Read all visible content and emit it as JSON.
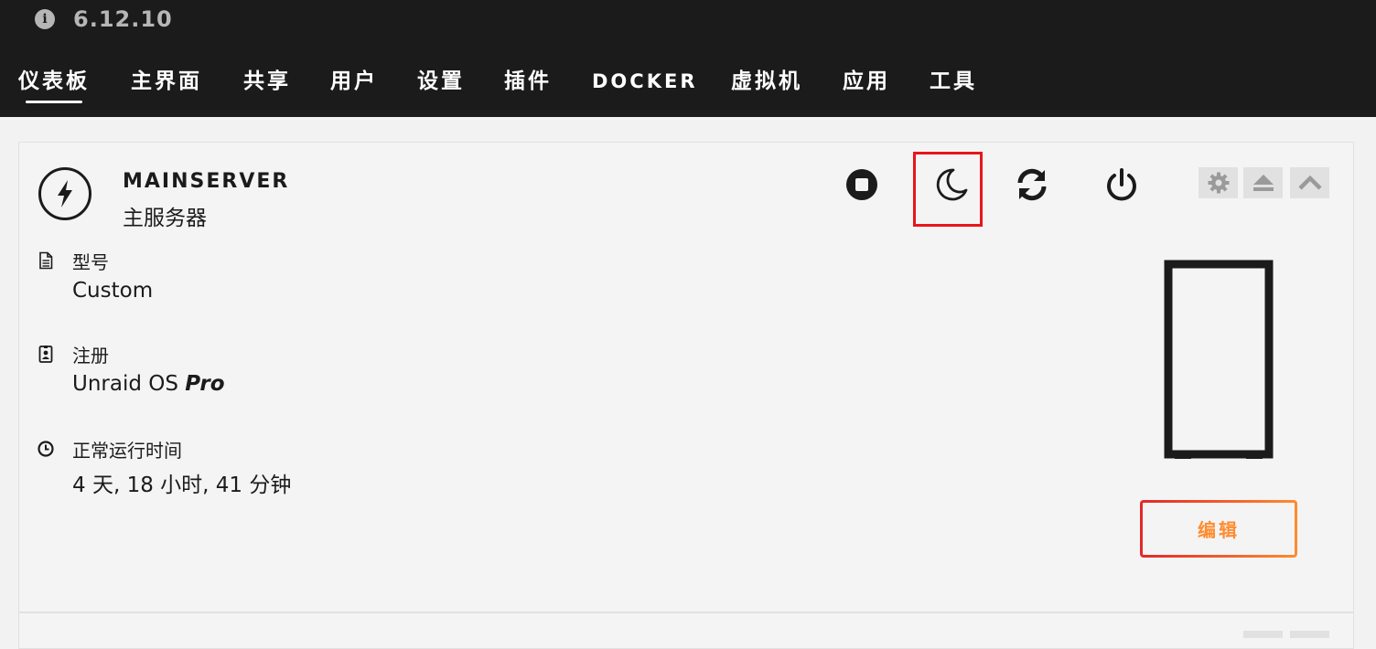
{
  "header": {
    "version": "6.12.10",
    "nav": [
      {
        "label": "仪表板",
        "active": true
      },
      {
        "label": "主界面"
      },
      {
        "label": "共享"
      },
      {
        "label": "用户"
      },
      {
        "label": "设置"
      },
      {
        "label": "插件"
      },
      {
        "label": "DOCKER"
      },
      {
        "label": "虚拟机"
      },
      {
        "label": "应用"
      },
      {
        "label": "工具"
      }
    ]
  },
  "server": {
    "name": "MAINSERVER",
    "description": "主服务器",
    "model_label": "型号",
    "model_value": "Custom",
    "registration_label": "注册",
    "registration_value": "Unraid OS",
    "registration_tier": "Pro",
    "uptime_label": "正常运行时间",
    "uptime_value": "4 天, 18 小时, 41 分钟",
    "edit_label": "编辑"
  },
  "icons": {
    "info": "info-icon",
    "server_logo": "lightning-bolt-icon",
    "stop": "stop-icon",
    "sleep": "moon-icon",
    "reboot": "refresh-icon",
    "power": "power-icon",
    "settings": "gear-icon",
    "eject": "eject-icon",
    "collapse": "chevron-up-icon"
  },
  "colors": {
    "header_bg": "#1c1b1b",
    "panel_bg": "#f4f4f4",
    "accent_orange": "#ff8c2f",
    "accent_red": "#e22828",
    "highlight": "#e8151b"
  }
}
